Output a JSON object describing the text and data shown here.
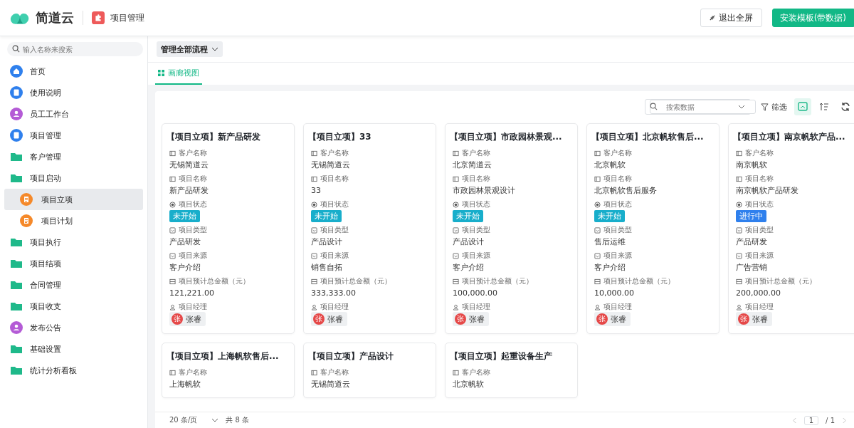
{
  "header": {
    "brand": "简道云",
    "app_title": "项目管理",
    "buttons": [
      {
        "label": "退出全屏",
        "kind": "exit"
      },
      {
        "label": "安装模板(带数据)",
        "kind": "primary"
      }
    ]
  },
  "sidebar": {
    "search": {
      "placeholder": "输入名称来搜索"
    },
    "items": [
      {
        "label": "首页",
        "kind": "home",
        "selected": false
      },
      {
        "label": "使用说明",
        "kind": "doc",
        "selected": false
      },
      {
        "label": "员工工作台",
        "kind": "person",
        "selected": false
      },
      {
        "label": "项目管理",
        "kind": "doc",
        "selected": false
      },
      {
        "label": "客户管理",
        "kind": "folder",
        "selected": false
      },
      {
        "label": "项目启动",
        "kind": "folder",
        "selected": false,
        "children": [
          {
            "label": "项目立项",
            "kind": "form",
            "selected": true
          },
          {
            "label": "项目计划",
            "kind": "form",
            "selected": false
          }
        ]
      },
      {
        "label": "项目执行",
        "kind": "folder",
        "selected": false
      },
      {
        "label": "项目结项",
        "kind": "folder",
        "selected": false
      },
      {
        "label": "合同管理",
        "kind": "folder",
        "selected": false
      },
      {
        "label": "项目收支",
        "kind": "folder",
        "selected": false
      },
      {
        "label": "发布公告",
        "kind": "person",
        "selected": false
      },
      {
        "label": "基础设置",
        "kind": "folder",
        "selected": false
      },
      {
        "label": "统计分析看板",
        "kind": "folder",
        "selected": false
      }
    ]
  },
  "flow_dropdown": "管理全部流程",
  "tabs": [
    {
      "label": "画廊视图",
      "selected": true
    }
  ],
  "toolbar": {
    "search": {
      "placeholder": "搜索数据"
    },
    "filter": "筛选"
  },
  "cards": [
    {
      "title": "【项目立项】新产品研发",
      "fields": [
        {
          "kind": "text",
          "label": "客户名称",
          "value": "无锡简道云"
        },
        {
          "kind": "text",
          "label": "项目名称",
          "value": "新产品研发"
        },
        {
          "kind": "status",
          "label": "项目状态",
          "value": "未开始",
          "color": "#18aecb"
        },
        {
          "kind": "select",
          "label": "项目类型",
          "value": "产品研发"
        },
        {
          "kind": "select",
          "label": "项目来源",
          "value": "客户介绍"
        },
        {
          "kind": "number",
          "label": "项目预计总金额（元）",
          "value": "121,221.00"
        },
        {
          "kind": "user",
          "label": "项目经理",
          "value": "张睿",
          "avatar": "张"
        }
      ]
    },
    {
      "title": "【项目立项】33",
      "fields": [
        {
          "kind": "text",
          "label": "客户名称",
          "value": "无锡简道云"
        },
        {
          "kind": "text",
          "label": "项目名称",
          "value": "33"
        },
        {
          "kind": "status",
          "label": "项目状态",
          "value": "未开始",
          "color": "#18aecb"
        },
        {
          "kind": "select",
          "label": "项目类型",
          "value": "产品设计"
        },
        {
          "kind": "select",
          "label": "项目来源",
          "value": "销售自拓"
        },
        {
          "kind": "number",
          "label": "项目预计总金额（元）",
          "value": "333,333.00"
        },
        {
          "kind": "user",
          "label": "项目经理",
          "value": "张睿",
          "avatar": "张"
        }
      ]
    },
    {
      "title": "【项目立项】市政园林景观...",
      "fields": [
        {
          "kind": "text",
          "label": "客户名称",
          "value": "北京简道云"
        },
        {
          "kind": "text",
          "label": "项目名称",
          "value": "市政园林景观设计"
        },
        {
          "kind": "status",
          "label": "项目状态",
          "value": "未开始",
          "color": "#18aecb"
        },
        {
          "kind": "select",
          "label": "项目类型",
          "value": "产品设计"
        },
        {
          "kind": "select",
          "label": "项目来源",
          "value": "客户介绍"
        },
        {
          "kind": "number",
          "label": "项目预计总金额（元）",
          "value": "100,000.00"
        },
        {
          "kind": "user",
          "label": "项目经理",
          "value": "张睿",
          "avatar": "张"
        }
      ]
    },
    {
      "title": "【项目立项】北京帆软售后...",
      "fields": [
        {
          "kind": "text",
          "label": "客户名称",
          "value": "北京帆软"
        },
        {
          "kind": "text",
          "label": "项目名称",
          "value": "北京帆软售后服务"
        },
        {
          "kind": "status",
          "label": "项目状态",
          "value": "未开始",
          "color": "#18aecb"
        },
        {
          "kind": "select",
          "label": "项目类型",
          "value": "售后运维"
        },
        {
          "kind": "select",
          "label": "项目来源",
          "value": "客户介绍"
        },
        {
          "kind": "number",
          "label": "项目预计总金额（元）",
          "value": "10,000.00"
        },
        {
          "kind": "user",
          "label": "项目经理",
          "value": "张睿",
          "avatar": "张"
        }
      ]
    },
    {
      "title": "【项目立项】南京帆软产品...",
      "fields": [
        {
          "kind": "text",
          "label": "客户名称",
          "value": "南京帆软"
        },
        {
          "kind": "text",
          "label": "项目名称",
          "value": "南京帆软产品研发"
        },
        {
          "kind": "status",
          "label": "项目状态",
          "value": "进行中",
          "color": "#2f80ed"
        },
        {
          "kind": "select",
          "label": "项目类型",
          "value": "产品研发"
        },
        {
          "kind": "select",
          "label": "项目来源",
          "value": "广告营销"
        },
        {
          "kind": "number",
          "label": "项目预计总金额（元）",
          "value": "200,000.00"
        },
        {
          "kind": "user",
          "label": "项目经理",
          "value": "张睿",
          "avatar": "张"
        }
      ]
    },
    {
      "title": "【项目立项】上海帆软售后...",
      "fields": [
        {
          "kind": "text",
          "label": "客户名称",
          "value": "上海帆软"
        }
      ]
    },
    {
      "title": "【项目立项】产品设计",
      "fields": [
        {
          "kind": "text",
          "label": "客户名称",
          "value": "无锡简道云"
        }
      ]
    },
    {
      "title": "【项目立项】起重设备生产",
      "fields": [
        {
          "kind": "text",
          "label": "客户名称",
          "value": "北京帆软"
        }
      ]
    }
  ],
  "pagination": {
    "page_size": "20 条/页",
    "total": "共 8 条",
    "page": "1",
    "pages": "/ 1"
  }
}
